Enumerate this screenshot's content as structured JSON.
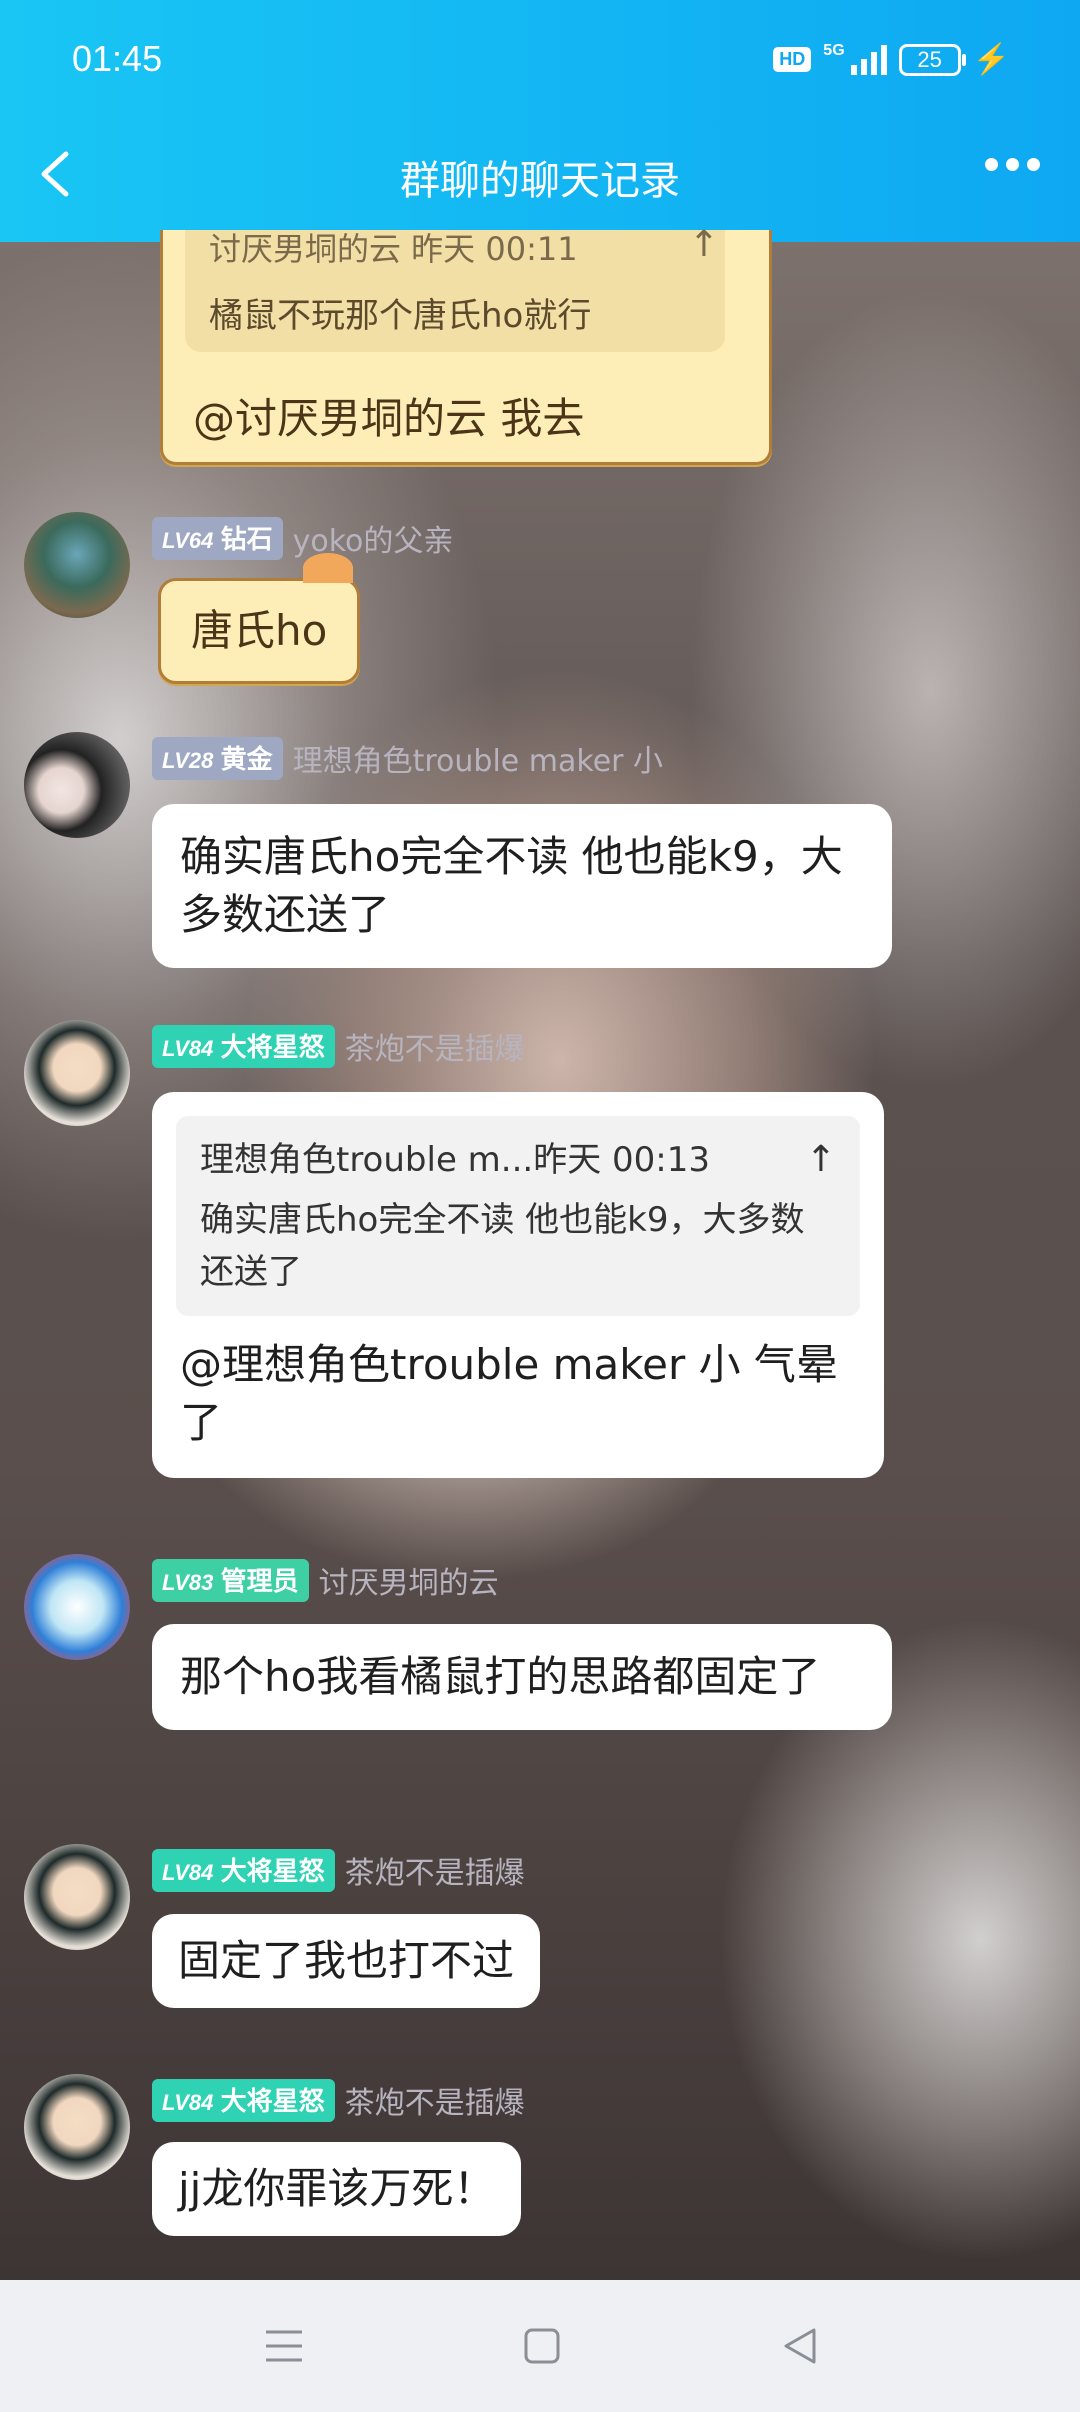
{
  "status": {
    "time": "01:45",
    "hd": "HD",
    "network": "5G",
    "battery": "25"
  },
  "header": {
    "title": "群聊的聊天记录"
  },
  "messages": [
    {
      "type": "paper-reply",
      "quote_header": "讨厌男垌的云 昨天 00:11",
      "quote_text": "橘鼠不玩那个唐氏ho就行",
      "text": "@讨厌男垌的云 我去"
    },
    {
      "level": "LV64",
      "rank": "钻石",
      "nick": "yoko的父亲",
      "text": "唐氏ho"
    },
    {
      "level": "LV28",
      "rank": "黄金",
      "nick": "理想角色trouble maker 小",
      "text": "确实唐氏ho完全不读 他也能k9，大多数还送了"
    },
    {
      "level": "LV84",
      "rank": "大将星怒",
      "nick": "茶炮不是插爆",
      "quote_header": "理想角色trouble m...昨天 00:13",
      "quote_text": "确实唐氏ho完全不读 他也能k9，大多数还送了",
      "text": "@理想角色trouble maker 小 气晕了"
    },
    {
      "level": "LV83",
      "rank": "管理员",
      "nick": "讨厌男垌的云",
      "text": "那个ho我看橘鼠打的思路都固定了"
    },
    {
      "level": "LV84",
      "rank": "大将星怒",
      "nick": "茶炮不是插爆",
      "text": "固定了我也打不过"
    },
    {
      "level": "LV84",
      "rank": "大将星怒",
      "nick": "茶炮不是插爆",
      "text": "jj龙你罪该万死！"
    }
  ],
  "colors": {
    "header_start": "#19c6f4",
    "header_end": "#0ea8f2",
    "paper": "#fdedb6",
    "level_teal": "#2fd3b4",
    "level_grey": "#9ea8c2"
  },
  "nav": {
    "icons": [
      "menu-icon",
      "home-square-icon",
      "back-triangle-icon"
    ]
  }
}
